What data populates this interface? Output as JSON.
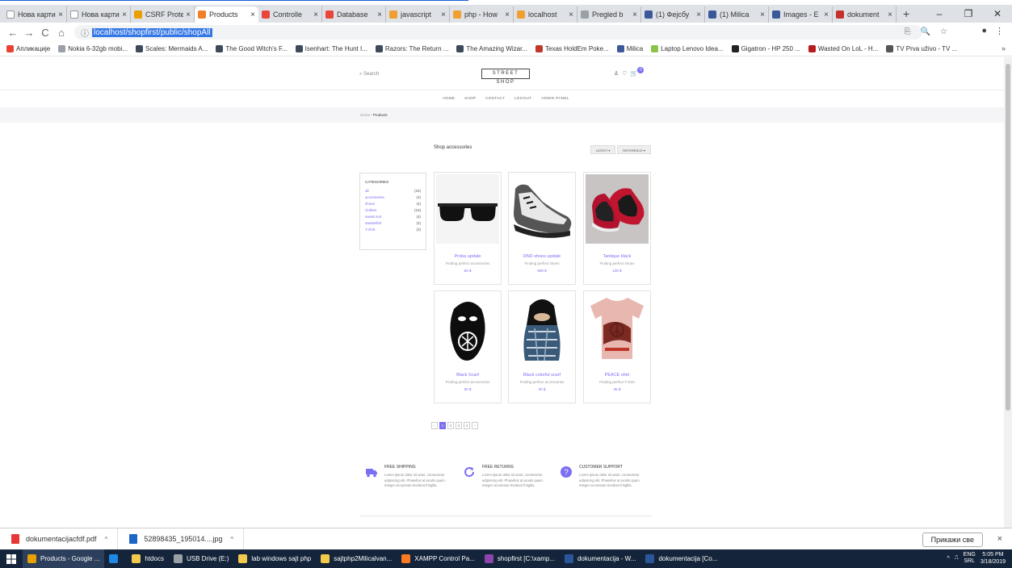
{
  "browser": {
    "tabs": [
      {
        "title": "Нова картица",
        "color": "#ffffff"
      },
      {
        "title": "Нова картица",
        "color": "#ffffff"
      },
      {
        "title": "CSRF Prote",
        "color": "#e8a000"
      },
      {
        "title": "Products",
        "color": "#f07f2a",
        "active": true
      },
      {
        "title": "Controlle",
        "color": "#e8463c"
      },
      {
        "title": "Database",
        "color": "#e8463c"
      },
      {
        "title": "javascript",
        "color": "#f0a030"
      },
      {
        "title": "php - How",
        "color": "#f0a030"
      },
      {
        "title": "localhost",
        "color": "#f0a030"
      },
      {
        "title": "Pregled b",
        "color": "#9aa0a6"
      },
      {
        "title": "(1) Фејсбу",
        "color": "#3b5998"
      },
      {
        "title": "(1) Milica",
        "color": "#3b5998"
      },
      {
        "title": "Images - E",
        "color": "#3b5998"
      },
      {
        "title": "dokument",
        "color": "#c4302b"
      }
    ],
    "tab_close": "×",
    "new_tab": "+",
    "window_controls": [
      "–",
      "❐",
      "✕"
    ],
    "nav": {
      "back": "←",
      "forward": "→",
      "reload": "C",
      "home": "⌂"
    },
    "url": "localhost/shopfirst/public/shopAll",
    "info_icon": "ⓘ",
    "omni_icons": [
      "⎘",
      "🔍",
      "☆"
    ],
    "nav_right": [
      "●",
      "⋮"
    ],
    "bookmarks": [
      {
        "label": "Апликације",
        "color": "#e94235"
      },
      {
        "label": "Nokia 6-32gb mobi...",
        "color": "#9aa0a6"
      },
      {
        "label": "Scales: Mermaids A...",
        "color": "#3c4a5c"
      },
      {
        "label": "The Good Witch's F...",
        "color": "#3c4a5c"
      },
      {
        "label": "Isenhart: The Hunt I...",
        "color": "#3c4a5c"
      },
      {
        "label": "Razors: The Return ...",
        "color": "#3c4a5c"
      },
      {
        "label": "The Amazing Wizar...",
        "color": "#3c4a5c"
      },
      {
        "label": "Texas HoldEm Poke...",
        "color": "#c0392b"
      },
      {
        "label": "Milica",
        "color": "#3b5998"
      },
      {
        "label": "Laptop Lenovo Idea...",
        "color": "#8bc34a"
      },
      {
        "label": "Gigatron - HP 250 ...",
        "color": "#222222"
      },
      {
        "label": "Wasted On LoL - H...",
        "color": "#b71c1c"
      },
      {
        "label": "TV Prva uživo - TV ...",
        "color": "#555555"
      }
    ],
    "bookmarks_more": "»"
  },
  "site": {
    "search": "Search",
    "logo": "STREET SHOP",
    "cart_count": "0",
    "menu": [
      "HOME",
      "SHOP",
      "CONTACT",
      "LOGOUT",
      "ADMIN PANEL"
    ],
    "breadcrumb": {
      "home": "Home",
      "sep": "/",
      "current": "Products"
    },
    "title": "Shop accessories",
    "sort_latest": "LATEST ▾",
    "sort_reference": "REFERENCE ▾",
    "categories": {
      "heading": "CATEGORIES",
      "items": [
        {
          "name": "all",
          "count": "(33)"
        },
        {
          "name": "accessories",
          "count": "(4)"
        },
        {
          "name": "shoes",
          "count": "(4)"
        },
        {
          "name": "clothes",
          "count": "(15)"
        },
        {
          "name": "sweat suit",
          "count": "(4)"
        },
        {
          "name": "sweatshirt",
          "count": "(4)"
        },
        {
          "name": "T-shirt",
          "count": "(3)"
        }
      ]
    },
    "products": [
      {
        "name": "Proba update",
        "desc": "Finding perfect accessories",
        "price": "60 $"
      },
      {
        "name": "DND shoes update",
        "desc": "Finding perfect shoes",
        "price": "900 $"
      },
      {
        "name": "Tanlique black",
        "desc": "Finding perfect shoes",
        "price": "100 $"
      },
      {
        "name": "Black Scarf",
        "desc": "Finding perfect accessories",
        "price": "50 $"
      },
      {
        "name": "Black colorful scarf",
        "desc": "Finding perfect accessories",
        "price": "30 $"
      },
      {
        "name": "PEACE shirt",
        "desc": "Finding perfect T-shirt",
        "price": "35 $"
      }
    ],
    "pagination": [
      "‹",
      "1",
      "2",
      "3",
      "4",
      "›"
    ],
    "features": [
      {
        "title": "FREE SHIPPING",
        "text": "Lorem ipsum dolor sit amet, consectetur adipiscing elit. Phasellus at iaculis quam. Integer accumsan tincidunt fringilla."
      },
      {
        "title": "FREE RETURNS",
        "text": "Lorem ipsum dolor sit amet, consectetur adipiscing elit. Phasellus at iaculis quam. Integer accumsan tincidunt fringilla."
      },
      {
        "title": "CUSTOMER SUPPORT",
        "text": "Lorem ipsum dolor sit amet, consectetur adipiscing elit. Phasellus at iaculis quam. Integer accumsan tincidunt fringilla."
      }
    ],
    "accent": "#7b6ef3"
  },
  "downloads": {
    "items": [
      {
        "name": "dokumentacijacfdf.pdf",
        "color": "#e53935"
      },
      {
        "name": "52898435_195014....jpg",
        "color": "#1e66c4"
      }
    ],
    "chev": "^",
    "show_all": "Прикажи све",
    "close": "×"
  },
  "taskbar": {
    "items": [
      {
        "label": "Products - Google ...",
        "color": "#e8a000",
        "run": true
      },
      {
        "label": "",
        "color": "#1e88e5"
      },
      {
        "label": "htdocs",
        "color": "#f2c94c"
      },
      {
        "label": "USB Drive (E:)",
        "color": "#9aa0a6"
      },
      {
        "label": "lab windows sajt php",
        "color": "#f2c94c"
      },
      {
        "label": "sajtphp2Milicalvan...",
        "color": "#f2c94c"
      },
      {
        "label": "XAMPP Control Pa...",
        "color": "#fb7a24"
      },
      {
        "label": "shopfirst [C:\\xamp...",
        "color": "#8e44ad"
      },
      {
        "label": "dokumentacija - W...",
        "color": "#2b579a"
      },
      {
        "label": "dokumentacija [Co...",
        "color": "#2b579a"
      }
    ],
    "tray_lang": "ENG",
    "tray_region": "SRL",
    "time": "5:05 PM",
    "date": "3/18/2019"
  }
}
